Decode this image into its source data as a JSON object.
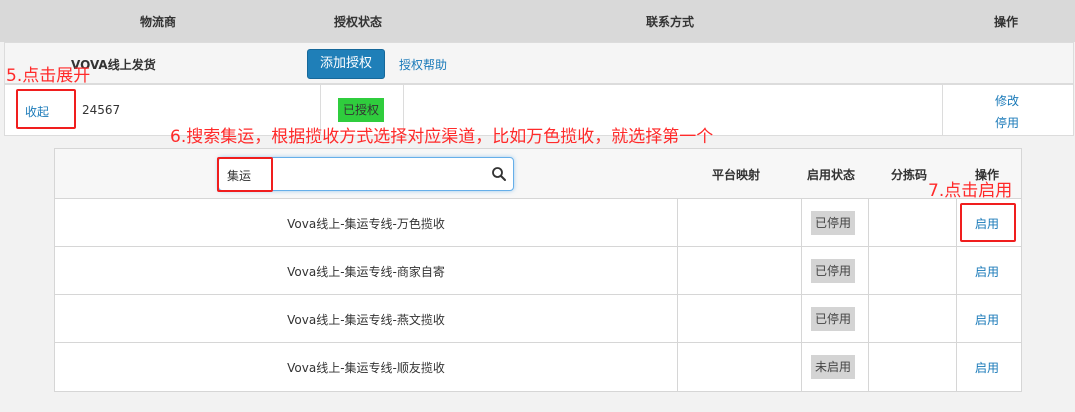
{
  "header": {
    "col_provider": "物流商",
    "col_auth_status": "授权状态",
    "col_contact": "联系方式",
    "col_action": "操作"
  },
  "provider_row": {
    "name": "VOVA线上发货",
    "add_auth_button": "添加授权",
    "auth_help_link": "授权帮助"
  },
  "account_row": {
    "collapse_link": "收起",
    "account_id": "24567",
    "auth_badge": "已授权",
    "edit_link": "修改",
    "disable_link": "停用"
  },
  "inner_table": {
    "search_value": "集运",
    "col_platform_map": "平台映射",
    "col_enable_status": "启用状态",
    "col_sort_code": "分拣码",
    "col_action": "操作",
    "rows": [
      {
        "name": "Vova线上-集运专线-万色揽收",
        "status": "已停用",
        "action": "启用"
      },
      {
        "name": "Vova线上-集运专线-商家自寄",
        "status": "已停用",
        "action": "启用"
      },
      {
        "name": "Vova线上-集运专线-燕文揽收",
        "status": "已停用",
        "action": "启用"
      },
      {
        "name": "Vova线上-集运专线-顺友揽收",
        "status": "未启用",
        "action": "启用"
      }
    ]
  },
  "annotations": {
    "step5": "5.点击展开",
    "step6": "6.搜索集运，根据揽收方式选择对应渠道，比如万色揽收，就选择第一个",
    "step7": "7.点击启用"
  },
  "colors": {
    "primary_button": "#1f7fb8",
    "link": "#1a7ab9",
    "auth_badge": "#2fcd3d",
    "annotation_red": "#ff2a2a"
  }
}
